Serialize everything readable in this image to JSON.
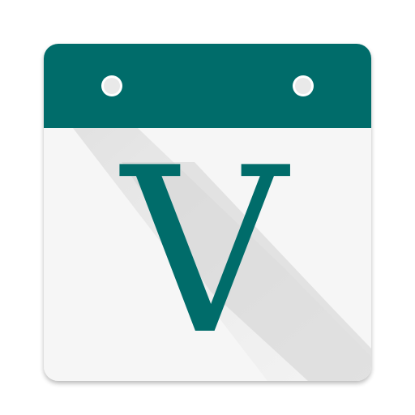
{
  "app_icon": {
    "letter": "V",
    "colors": {
      "header": "#006c6a",
      "letter": "#006c6a",
      "page": "#f6f6f6",
      "hole": "#e9e9e9",
      "hole_ring": "#ffffff",
      "long_shadow": "#d6d6d6"
    },
    "icons": {
      "calendar": "calendar-icon",
      "binding_holes": [
        "binding-hole-left-icon",
        "binding-hole-right-icon"
      ]
    }
  }
}
